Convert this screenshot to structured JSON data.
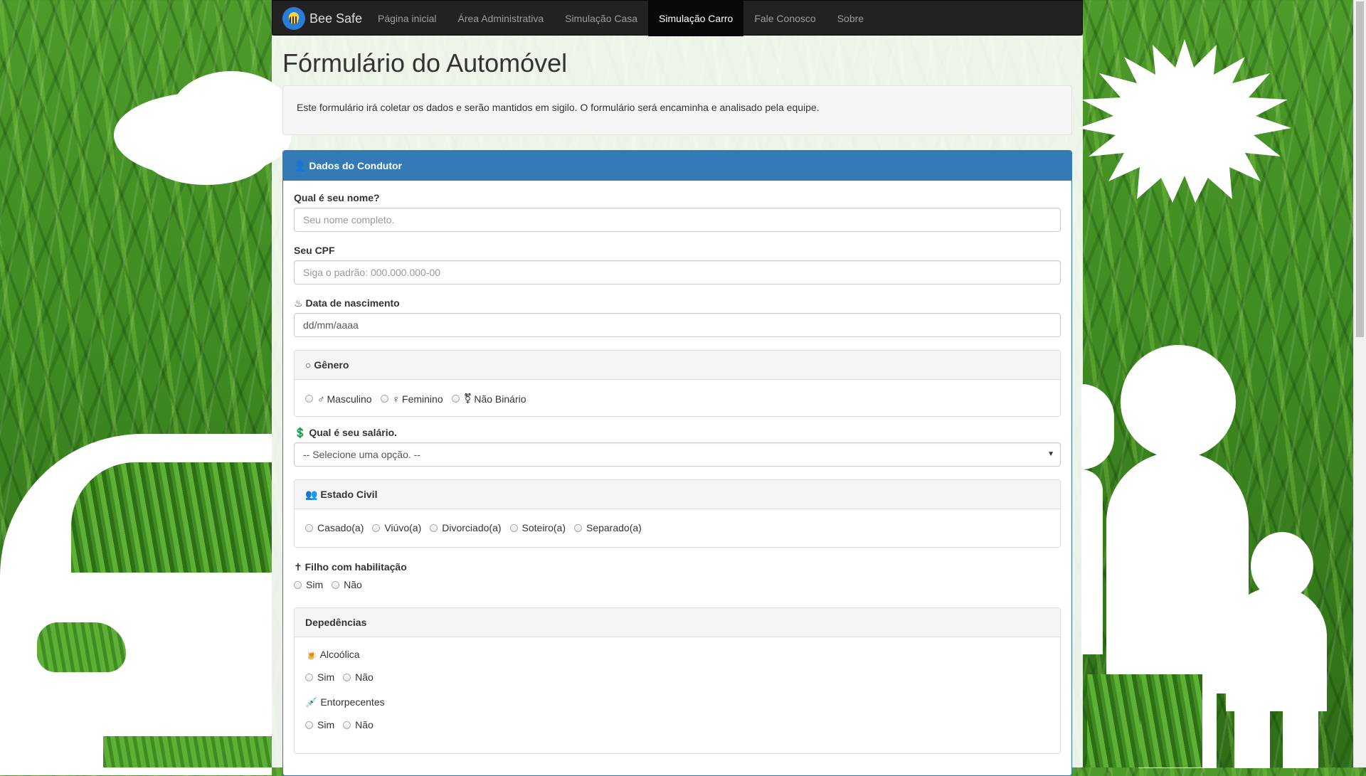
{
  "nav": {
    "brand": "Bee Safe",
    "items": [
      {
        "label": "Página inicial"
      },
      {
        "label": "Área Administrativa"
      },
      {
        "label": "Simulação Casa"
      },
      {
        "label": "Simulação Carro",
        "active": true
      },
      {
        "label": "Fale Conosco"
      },
      {
        "label": "Sobre"
      }
    ]
  },
  "page": {
    "title": "Fórmulário do Automóvel",
    "intro": "Este formulário irá coletar os dados e serão mantidos em sigilo. O formulário será encaminha e analisado pela equipe."
  },
  "panel": {
    "heading": "Dados do Condutor",
    "name": {
      "label": "Qual é seu nome?",
      "placeholder": "Seu nome completo."
    },
    "cpf": {
      "label": "Seu CPF",
      "placeholder": "Siga o padrão: 000.000.000-00"
    },
    "birth": {
      "label": "Data de nascimento",
      "value": "dd/mm/aaaa"
    },
    "gender": {
      "heading": "Gênero",
      "options": [
        {
          "symbol": "♂",
          "label": "Masculino"
        },
        {
          "symbol": "♀",
          "label": "Feminino"
        },
        {
          "symbol": "⚧",
          "label": "Não Binário"
        }
      ]
    },
    "salary": {
      "label": "Qual é seu salário.",
      "selected": "-- Selecione uma opção. --"
    },
    "civil": {
      "heading": "Estado Civil",
      "options": [
        "Casado(a)",
        "Viúvo(a)",
        "Divorciado(a)",
        "Soteiro(a)",
        "Separado(a)"
      ]
    },
    "child": {
      "label": "Filho com habilitação",
      "options": [
        "Sim",
        "Não"
      ]
    },
    "deps": {
      "heading": "Depedências",
      "alcohol": {
        "label": "Alcoólica",
        "options": [
          "Sim",
          "Não"
        ]
      },
      "drugs": {
        "label": "Entorpecentes",
        "options": [
          "Sim",
          "Não"
        ]
      }
    }
  }
}
